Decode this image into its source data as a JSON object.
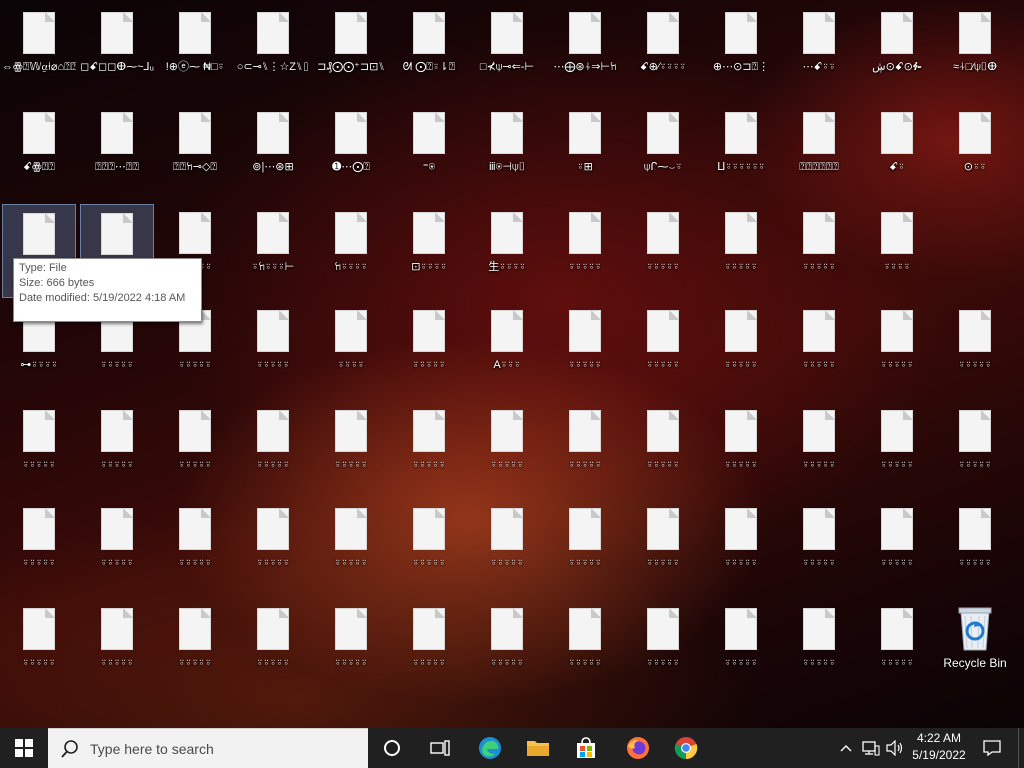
{
  "desktop": {
    "icons": [
      [
        "⇔ꙮ⍰𝕎⍶⍿⌀⌂⍰⍰⍰",
        "◻ꗃ◻◻ⴲ⁓~⅃ᵤ",
        "!⊕ⓔ⁓ ₦□⍤",
        "○⊂⊸⑊⋮☆Z⑊⌷",
        "⊐₰⨀⨀⁺⊐⊡⑊",
        "ᘛ ⨀⍰⍤⇂⍰",
        "□⊀⍦⊸⇐-⊢",
        "⋯⨁⊛⍭⇒⊢ꖷ",
        "ꗃ⊕⁄⍤⍤⍤⍤",
        "⊕⋯⊙⊐⍰⋮",
        "⋯ꗃ⍤⍤",
        "ڜ⊙ꗃ⊙ᎊ",
        "≈⍭□⁄⍦⌷ⴲ"
      ],
      [
        "ꗃꙮ⍰⍰",
        "⍰⍰⍰⋯⍰⍰",
        "⍰⍰ꖷ⊸◇⍰",
        "⊚|⋯⊛⊞",
        "➊⋯⨀⍰",
        "⁼⍟",
        "ⅲ⍟⊣⍦⌷",
        "⍤⊞",
        "⍦ᒋ⁓⌣⍤",
        "ⵡ⍤⍤⍤⍤⍤⍤",
        "⍰⍰⍰⍰⍰⍰",
        "ꗃ⍤",
        "⊙⍤⍤"
      ],
      [
        "⌓⁻⍤⍤⍤⍤⍤",
        "⍰⍰⍰⍰⍰",
        "⏙⍤⍤⍤⍤",
        "⍤ꖷ⍤⍤⍤⊢",
        "ꖷ⍤⍤⍤⍤",
        "⊡⍤⍤⍤⍤",
        "生⍤⍤⍤⍤",
        "⍤⍤⍤⍤⍤",
        "⍤⍤⍤⍤⍤",
        "⍤⍤⍤⍤⍤",
        "⍤⍤⍤⍤⍤",
        "⍤⍤⍤⍤"
      ],
      [
        "⊶⍤⍤⍤⍤",
        "⍤⍤⍤⍤⍤",
        "⍤⍤⍤⍤⍤",
        "⍤⍤⍤⍤⍤",
        "⍤⍤⍤⍤",
        "⍤⍤⍤⍤⍤",
        "A⍤⍤⍤",
        "⍤⍤⍤⍤⍤",
        "⍤⍤⍤⍤⍤",
        "⍤⍤⍤⍤⍤",
        "⍤⍤⍤⍤⍤",
        "⍤⍤⍤⍤⍤",
        "⍤⍤⍤⍤⍤"
      ],
      [
        "⍤⍤⍤⍤⍤",
        "⍤⍤⍤⍤⍤",
        "⍤⍤⍤⍤⍤",
        "⍤⍤⍤⍤⍤",
        "⍤⍤⍤⍤⍤",
        "⍤⍤⍤⍤⍤",
        "⍤⍤⍤⍤⍤",
        "⍤⍤⍤⍤⍤",
        "⍤⍤⍤⍤⍤",
        "⍤⍤⍤⍤⍤",
        "⍤⍤⍤⍤⍤",
        "⍤⍤⍤⍤⍤",
        "⍤⍤⍤⍤⍤"
      ],
      [
        "⍤⍤⍤⍤⍤",
        "⍤⍤⍤⍤⍤",
        "⍤⍤⍤⍤⍤",
        "⍤⍤⍤⍤⍤",
        "⍤⍤⍤⍤⍤",
        "⍤⍤⍤⍤⍤",
        "⍤⍤⍤⍤⍤",
        "⍤⍤⍤⍤⍤",
        "⍤⍤⍤⍤⍤",
        "⍤⍤⍤⍤⍤",
        "⍤⍤⍤⍤⍤",
        "⍤⍤⍤⍤⍤",
        "⍤⍤⍤⍤⍤"
      ],
      [
        "⍤⍤⍤⍤⍤",
        "⍤⍤⍤⍤⍤",
        "⍤⍤⍤⍤⍤",
        "⍤⍤⍤⍤⍤",
        "⍤⍤⍤⍤⍤",
        "⍤⍤⍤⍤⍤",
        "⍤⍤⍤⍤⍤",
        "⍤⍤⍤⍤⍤",
        "⍤⍤⍤⍤⍤",
        "⍤⍤⍤⍤⍤",
        "⍤⍤⍤⍤⍤",
        "⍤⍤⍤⍤⍤"
      ]
    ],
    "recycle_bin_label": "Recycle Bin"
  },
  "tooltip": {
    "type": "Type: File",
    "size": "Size: 666 bytes",
    "modified": "Date modified: 5/19/2022 4:18 AM"
  },
  "taskbar": {
    "search_placeholder": "Type here to search",
    "time": "4:22 AM",
    "date": "5/19/2022",
    "colors": {
      "bg": "#202020",
      "edge": "#0078d7",
      "firefox": "#ff7139",
      "chrome": "#db4437"
    }
  }
}
